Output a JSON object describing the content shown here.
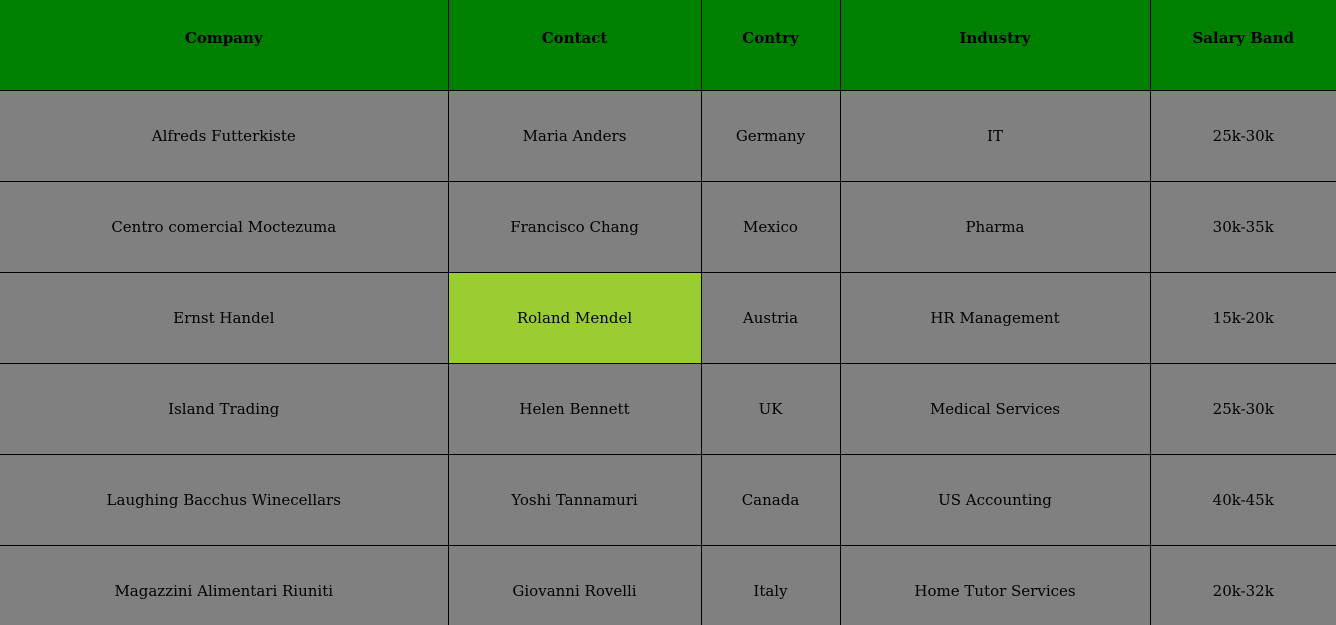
{
  "table": {
    "headers": [
      "Company",
      "Contact",
      "Contry",
      "Industry",
      "Salary Band"
    ],
    "rows": [
      [
        "Alfreds Futterkiste",
        "Maria Anders",
        "Germany",
        "IT",
        "25k-30k"
      ],
      [
        "Centro comercial Moctezuma",
        "Francisco Chang",
        "Mexico",
        "Pharma",
        "30k-35k"
      ],
      [
        "Ernst Handel",
        "Roland Mendel",
        "Austria",
        "HR Management",
        "15k-20k"
      ],
      [
        "Island Trading",
        "Helen Bennett",
        "UK",
        "Medical Services",
        "25k-30k"
      ],
      [
        "Laughing Bacchus Winecellars",
        "Yoshi Tannamuri",
        "Canada",
        "US Accounting",
        "40k-45k"
      ],
      [
        "Magazzini Alimentari Riuniti",
        "Giovanni Rovelli",
        "Italy",
        "Home Tutor Services",
        "20k-32k"
      ]
    ]
  },
  "colors": {
    "header_bg": "#008000",
    "cell_bg": "#808080",
    "highlight_bg": "#9acd32"
  }
}
